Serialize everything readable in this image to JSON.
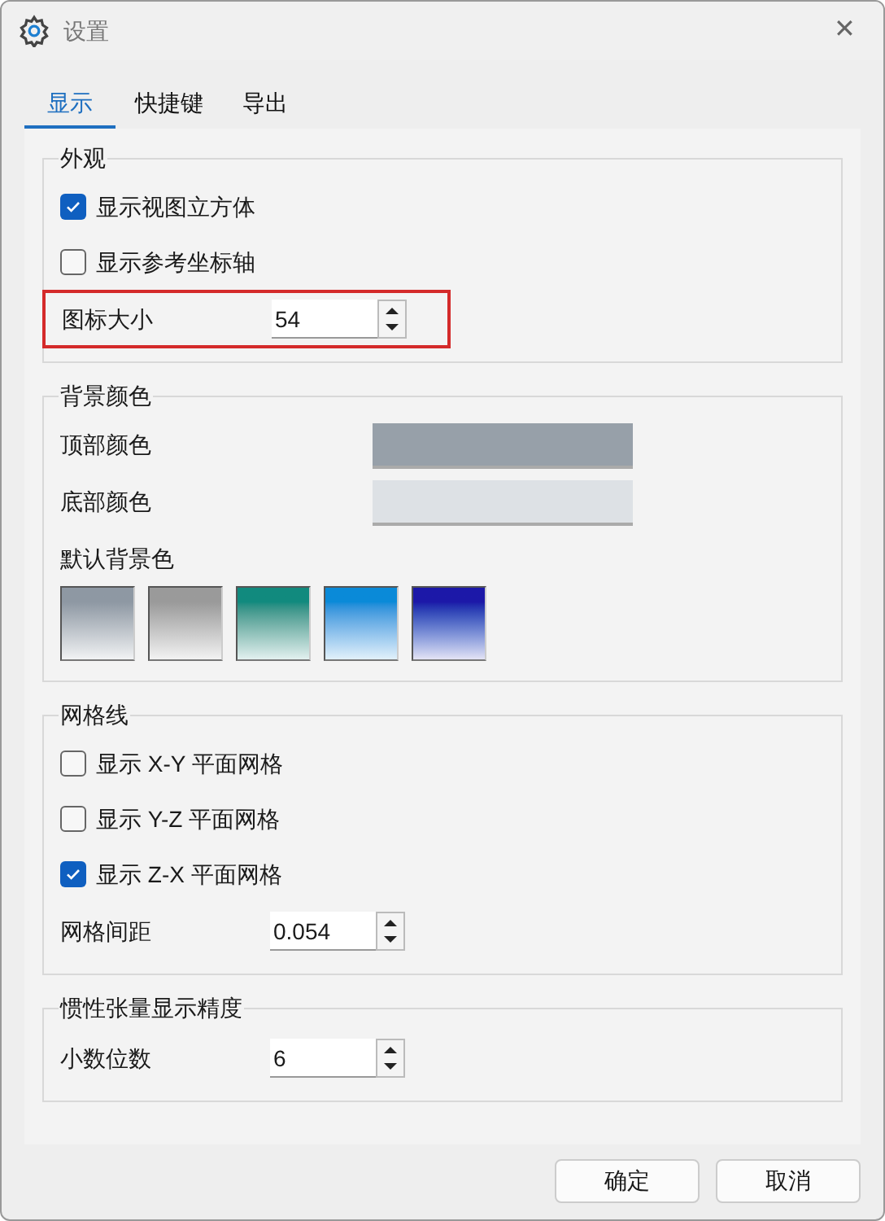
{
  "window": {
    "title": "设置",
    "close": "✕"
  },
  "tabs": [
    {
      "label": "显示",
      "selected": true
    },
    {
      "label": "快捷键",
      "selected": false
    },
    {
      "label": "导出",
      "selected": false
    }
  ],
  "groups": [
    {
      "title": "外观",
      "items": [
        {
          "kind": "checkbox",
          "label": "显示视图立方体",
          "checked": true
        },
        {
          "kind": "checkbox",
          "label": "显示参考坐标轴",
          "checked": false
        },
        {
          "kind": "spinner",
          "label": "图标大小",
          "value": "54",
          "highlighted": true
        }
      ]
    },
    {
      "title": "背景颜色",
      "items": [
        {
          "kind": "color",
          "label": "顶部颜色",
          "color": "#97a0a9"
        },
        {
          "kind": "color",
          "label": "底部颜色",
          "color": "#dde1e5"
        },
        {
          "kind": "presets",
          "label": "默认背景色",
          "swatches": [
            {
              "color": "#8e98a3"
            },
            {
              "color": "#9a9a9a"
            },
            {
              "color": "#118a7e"
            },
            {
              "color": "#0a8ad8"
            },
            {
              "color": "#1c18a8"
            }
          ]
        }
      ]
    },
    {
      "title": "网格线",
      "items": [
        {
          "kind": "checkbox",
          "label": "显示 X-Y 平面网格",
          "checked": false
        },
        {
          "kind": "checkbox",
          "label": "显示 Y-Z 平面网格",
          "checked": false
        },
        {
          "kind": "checkbox",
          "label": "显示 Z-X 平面网格",
          "checked": true
        },
        {
          "kind": "spinner",
          "label": "网格间距",
          "value": "0.054",
          "highlighted": false
        }
      ]
    },
    {
      "title": "惯性张量显示精度",
      "items": [
        {
          "kind": "spinner",
          "label": "小数位数",
          "value": "6",
          "highlighted": false
        }
      ]
    }
  ],
  "buttons": [
    "确定",
    "取消"
  ]
}
